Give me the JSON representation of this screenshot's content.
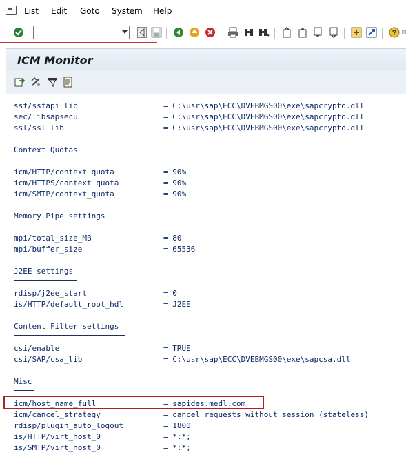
{
  "menubar": {
    "items": [
      "List",
      "Edit",
      "Goto",
      "System",
      "Help"
    ]
  },
  "toolbar": {
    "command_field_value": ""
  },
  "page": {
    "title": "ICM Monitor"
  },
  "app_toolbar": {
    "icons": [
      "refresh-icon",
      "change-icon",
      "filter-icon",
      "document-icon"
    ]
  },
  "content": {
    "groups": [
      {
        "section": "",
        "params": [
          {
            "key": "ssf/ssfapi_lib",
            "value": "= C:\\usr\\sap\\ECC\\DVEBMGS00\\exe\\sapcrypto.dll"
          },
          {
            "key": "sec/libsapsecu",
            "value": "= C:\\usr\\sap\\ECC\\DVEBMGS00\\exe\\sapcrypto.dll"
          },
          {
            "key": "ssl/ssl_lib",
            "value": "= C:\\usr\\sap\\ECC\\DVEBMGS00\\exe\\sapcrypto.dll"
          }
        ]
      },
      {
        "section": "Context Quotas",
        "params": [
          {
            "key": "icm/HTTP/context_quota",
            "value": "= 90%"
          },
          {
            "key": "icm/HTTPS/context_quota",
            "value": "= 90%"
          },
          {
            "key": "icm/SMTP/context_quota",
            "value": "= 90%"
          }
        ]
      },
      {
        "section": "Memory Pipe settings",
        "params": [
          {
            "key": "mpi/total_size_MB",
            "value": "= 80"
          },
          {
            "key": "mpi/buffer_size",
            "value": "= 65536"
          }
        ]
      },
      {
        "section": "J2EE settings",
        "params": [
          {
            "key": "rdisp/j2ee_start",
            "value": "= 0"
          },
          {
            "key": "is/HTTP/default_root_hdl",
            "value": "= J2EE"
          }
        ]
      },
      {
        "section": "Content Filter settings",
        "params": [
          {
            "key": "csi/enable",
            "value": "= TRUE"
          },
          {
            "key": "csi/SAP/csa_lib",
            "value": "= C:\\usr\\sap\\ECC\\DVEBMGS00\\exe\\sapcsa.dll"
          }
        ]
      },
      {
        "section": "Misc",
        "params": [
          {
            "key": "icm/host_name_full",
            "value": "= sapides.medl.com"
          },
          {
            "key": "icm/cancel_strategy",
            "value": "= cancel requests without session (stateless)"
          },
          {
            "key": "rdisp/plugin_auto_logout",
            "value": "= 1800"
          },
          {
            "key": "is/HTTP/virt_host_0",
            "value": "= *:*;"
          },
          {
            "key": "is/SMTP/virt_host_0",
            "value": "= *:*;"
          }
        ]
      }
    ]
  }
}
